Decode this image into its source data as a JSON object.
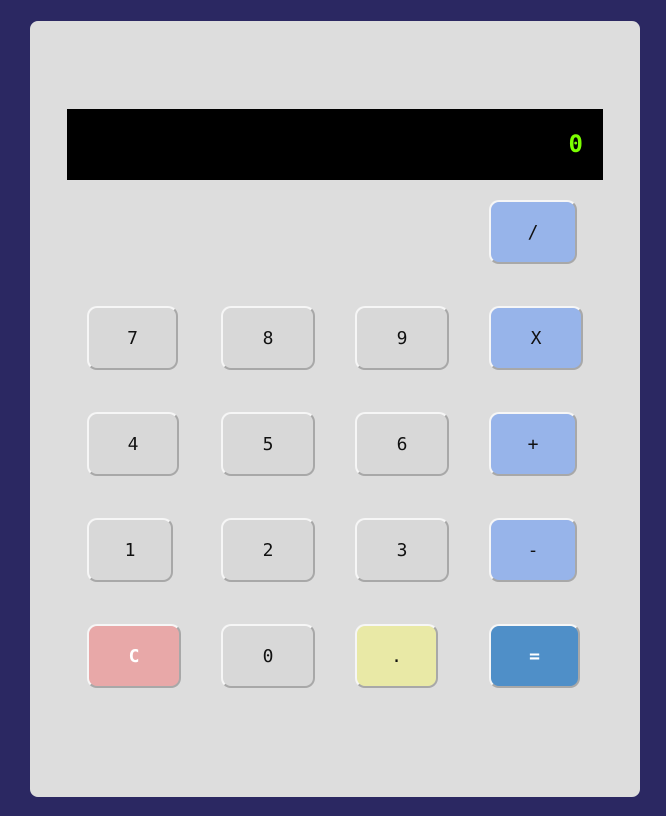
{
  "display": {
    "value": "0"
  },
  "keys": {
    "divide": "/",
    "seven": "7",
    "eight": "8",
    "nine": "9",
    "multiply": "X",
    "four": "4",
    "five": "5",
    "six": "6",
    "add": "+",
    "one": "1",
    "two": "2",
    "three": "3",
    "subtract": "-",
    "clear": "C",
    "zero": "0",
    "decimal": ".",
    "equals": "="
  },
  "colors": {
    "page_background": "#2b2862",
    "body": "#dddddd",
    "display_background": "#000000",
    "display_text": "#7bff00",
    "number_key": "#d8d8d8",
    "operator_key": "#97b4ea",
    "clear_key": "#e8a8a8",
    "decimal_key": "#e9e9a6",
    "equals_key": "#4f8fc8"
  }
}
